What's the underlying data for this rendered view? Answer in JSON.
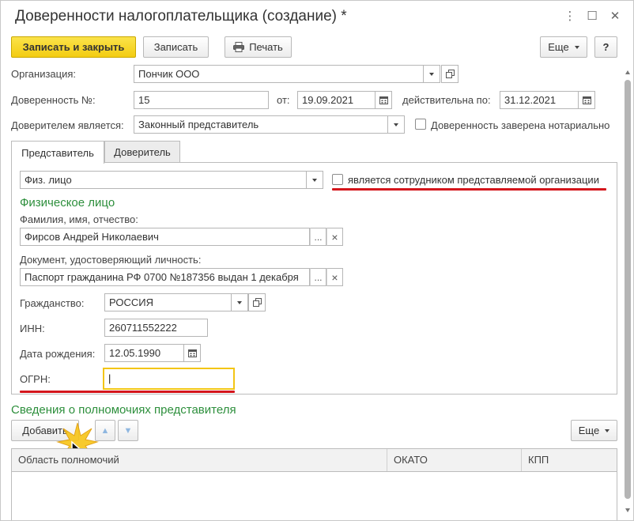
{
  "window": {
    "title": "Доверенности налогоплательщика (создание) *",
    "controls": {
      "menu": "⋮",
      "maximize": "☐",
      "close": "✕"
    }
  },
  "toolbar": {
    "save_close": "Записать и закрыть",
    "save": "Записать",
    "print": "Печать",
    "more": "Еще",
    "help": "?"
  },
  "form": {
    "org_label": "Организация:",
    "org_value": "Пончик ООО",
    "poa_label": "Доверенность №:",
    "poa_value": "15",
    "from_label": "от:",
    "from_value": "19.09.2021",
    "valid_label": "действительна по:",
    "valid_value": "31.12.2021",
    "principal_label": "Доверителем является:",
    "principal_value": "Законный представитель",
    "notary_label": "Доверенность заверена нотариально"
  },
  "tabs": [
    {
      "label": "Представитель"
    },
    {
      "label": "Доверитель"
    }
  ],
  "rep": {
    "type_value": "Физ. лицо",
    "employee_label": "является сотрудником представляемой организации",
    "section_title": "Физическое лицо",
    "fio_label": "Фамилия, имя, отчество:",
    "fio_value": "Фирсов Андрей Николаевич",
    "doc_label": "Документ, удостоверяющий личность:",
    "doc_value": "Паспорт гражданина РФ 0700 №187356 выдан 1 декабря",
    "citizenship_label": "Гражданство:",
    "citizenship_value": "РОССИЯ",
    "inn_label": "ИНН:",
    "inn_value": "260711552222",
    "birth_label": "Дата рождения:",
    "birth_value": "12.05.1990",
    "ogrn_label": "ОГРН:",
    "ogrn_value": "|"
  },
  "powers": {
    "section_title": "Сведения о полномочиях представителя",
    "add_label": "Добавить",
    "more_label": "Еще",
    "columns": [
      "Область полномочий",
      "ОКАТО",
      "КПП"
    ]
  },
  "glyphs": {
    "ellipsis": "...",
    "clear": "×",
    "chevron_down": "▾",
    "arrow_up": "▲",
    "arrow_down": "▼"
  },
  "colors": {
    "accent_yellow": "#f5d21a",
    "section_green": "#2d8f3c",
    "highlight_red": "#d4161c"
  }
}
